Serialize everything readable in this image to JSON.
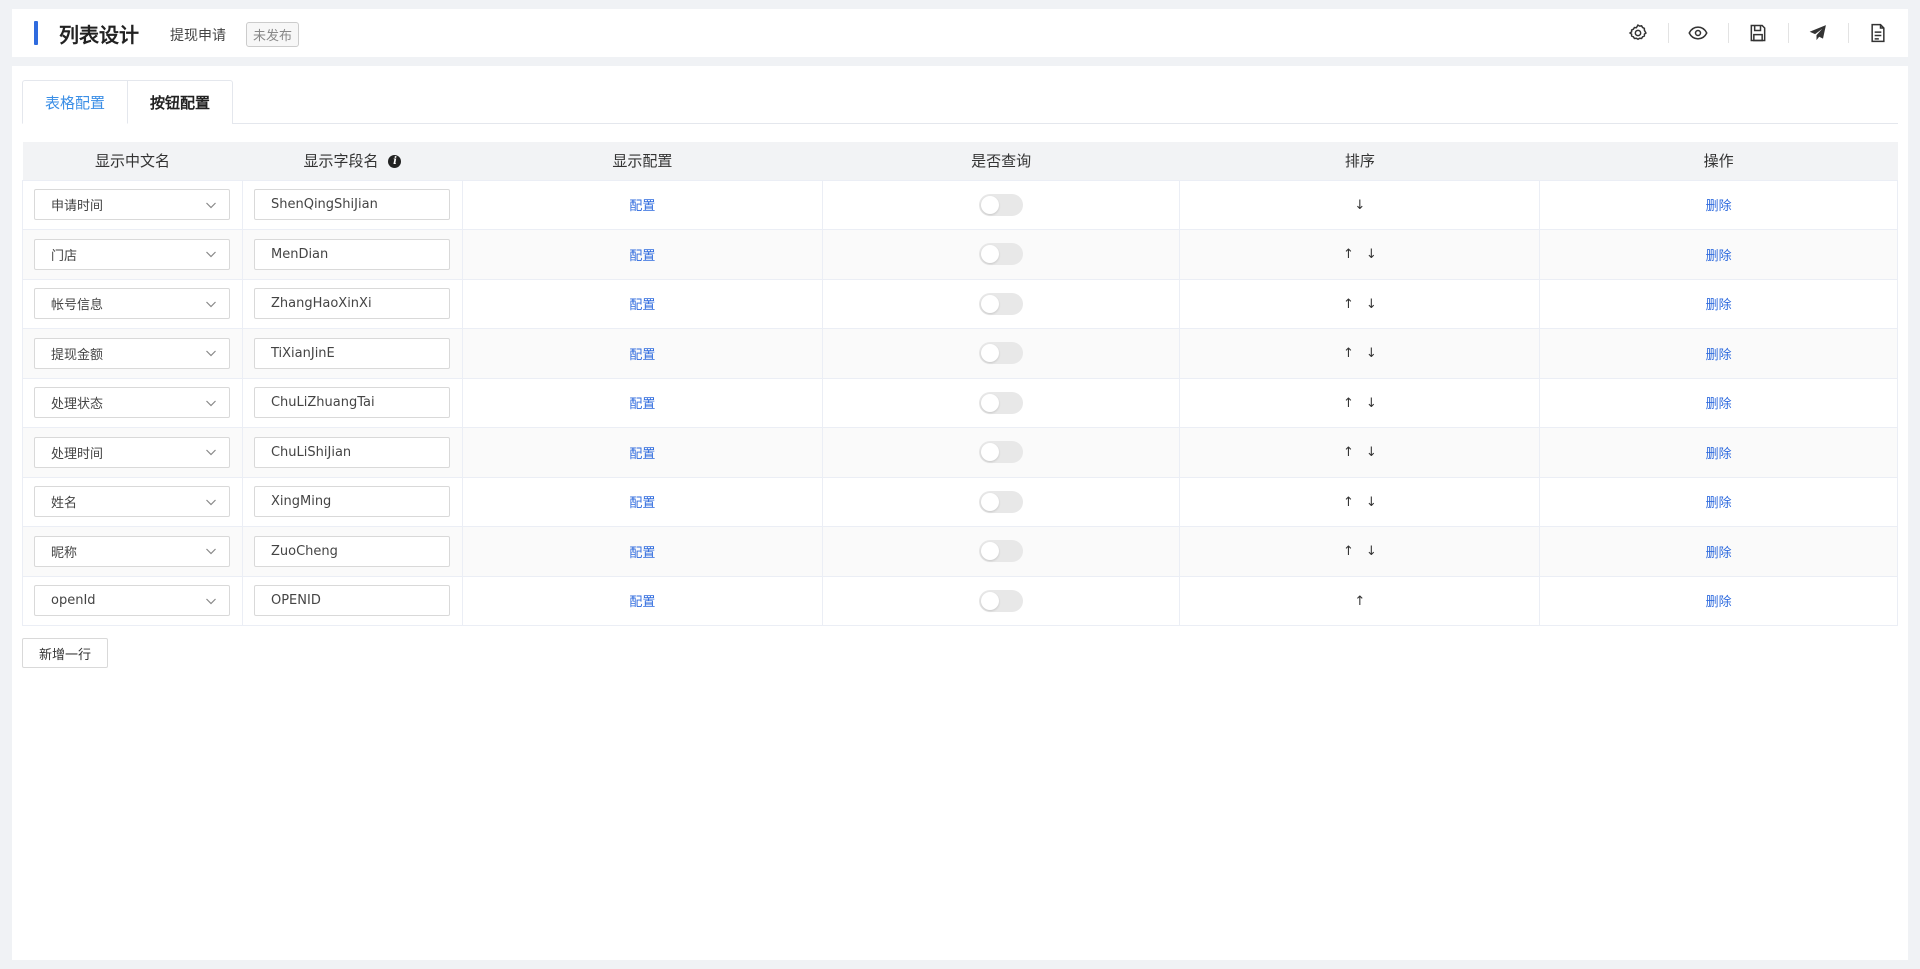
{
  "header": {
    "title": "列表设计",
    "subtitle": "提现申请",
    "status_badge": "未发布",
    "toolbar": [
      "gear-icon",
      "eye-icon",
      "save-icon",
      "send-icon",
      "document-icon"
    ]
  },
  "colors": {
    "accent": "#2f6bde",
    "tab_active": "#3a8ee6",
    "link": "#2f6bde"
  },
  "tabs": [
    {
      "label": "表格配置",
      "active": true
    },
    {
      "label": "按钮配置",
      "active": false
    }
  ],
  "table": {
    "headers": [
      "显示中文名",
      "显示字段名",
      "显示配置",
      "是否查询",
      "排序",
      "操作"
    ],
    "config_label": "配置",
    "delete_label": "删除",
    "rows": [
      {
        "name": "申请时间",
        "field": "ShenQingShiJian",
        "up": false,
        "down": true
      },
      {
        "name": "门店",
        "field": "MenDian",
        "up": true,
        "down": true
      },
      {
        "name": "帐号信息",
        "field": "ZhangHaoXinXi",
        "up": true,
        "down": true
      },
      {
        "name": "提现金额",
        "field": "TiXianJinE",
        "up": true,
        "down": true
      },
      {
        "name": "处理状态",
        "field": "ChuLiZhuangTai",
        "up": true,
        "down": true
      },
      {
        "name": "处理时间",
        "field": "ChuLiShiJian",
        "up": true,
        "down": true
      },
      {
        "name": "姓名",
        "field": "XingMing",
        "up": true,
        "down": true
      },
      {
        "name": "昵称",
        "field": "ZuoCheng",
        "up": true,
        "down": true
      },
      {
        "name": "openId",
        "field": "OPENID",
        "up": true,
        "down": false
      }
    ]
  },
  "add_row_label": "新增一行"
}
